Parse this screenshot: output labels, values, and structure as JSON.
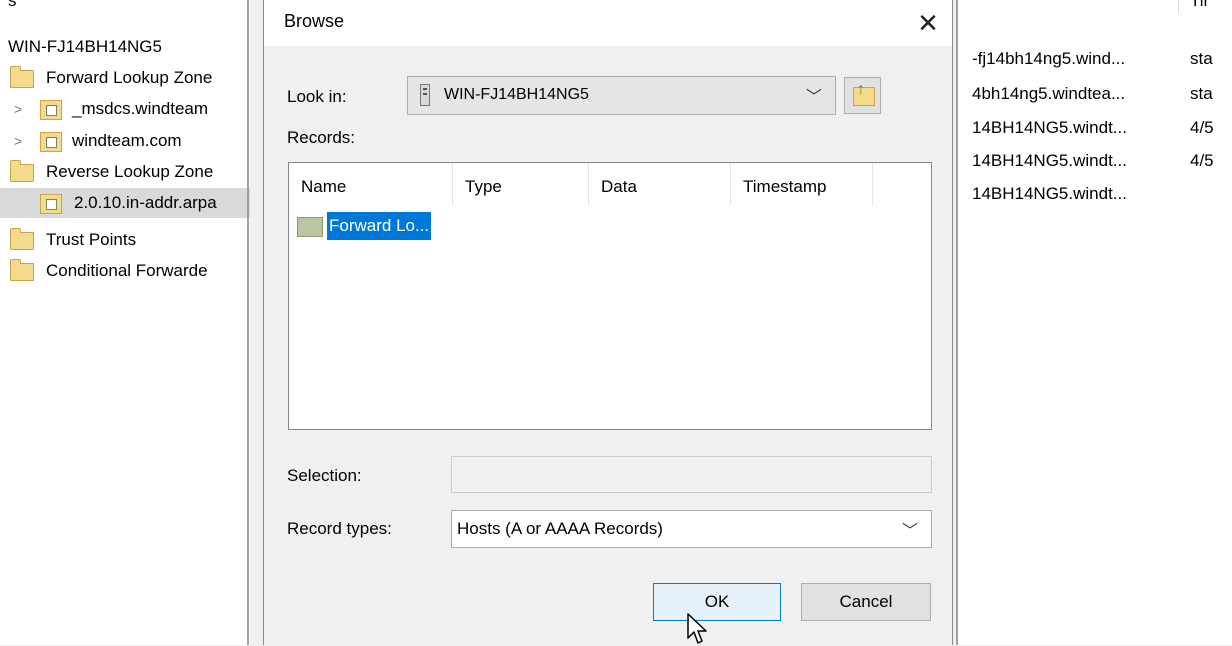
{
  "tree": {
    "top_fragment": "s",
    "server": "WIN-FJ14BH14NG5",
    "items": [
      {
        "label": "Forward Lookup Zone",
        "type": "folder"
      },
      {
        "label": "_msdcs.windteam",
        "type": "zone",
        "chevron": ">"
      },
      {
        "label": "windteam.com",
        "type": "zone",
        "chevron": ">"
      },
      {
        "label": "Reverse Lookup Zone",
        "type": "folder"
      },
      {
        "label": "2.0.10.in-addr.arpa",
        "type": "zone",
        "selected": true
      },
      {
        "label": "Trust Points",
        "type": "folder"
      },
      {
        "label": "Conditional Forwarde",
        "type": "folder"
      }
    ]
  },
  "list": {
    "header_fragment": "Tir",
    "rows": [
      {
        "c1": "-fj14bh14ng5.wind...",
        "c2": "sta"
      },
      {
        "c1": "4bh14ng5.windtea...",
        "c2": "sta"
      },
      {
        "c1": "14BH14NG5.windt...",
        "c2": "4/5"
      },
      {
        "c1": "14BH14NG5.windt...",
        "c2": "4/5"
      },
      {
        "c1": "14BH14NG5.windt...",
        "c2": ""
      }
    ]
  },
  "dialog": {
    "title": "Browse",
    "close_glyph": "✕",
    "look_in_label": "Look in:",
    "look_in_value": "WIN-FJ14BH14NG5",
    "records_label": "Records:",
    "columns": [
      "Name",
      "Type",
      "Data",
      "Timestamp"
    ],
    "record_item": "Forward Lo...",
    "selection_label": "Selection:",
    "selection_value": "",
    "record_types_label": "Record types:",
    "record_types_value": "Hosts (A or AAAA Records)",
    "ok_label": "OK",
    "cancel_label": "Cancel",
    "dropdown_glyph": "﹀"
  },
  "colors": {
    "selection": "#0078d7",
    "ok_border": "#0078d7",
    "folder": "#f5d98c"
  }
}
